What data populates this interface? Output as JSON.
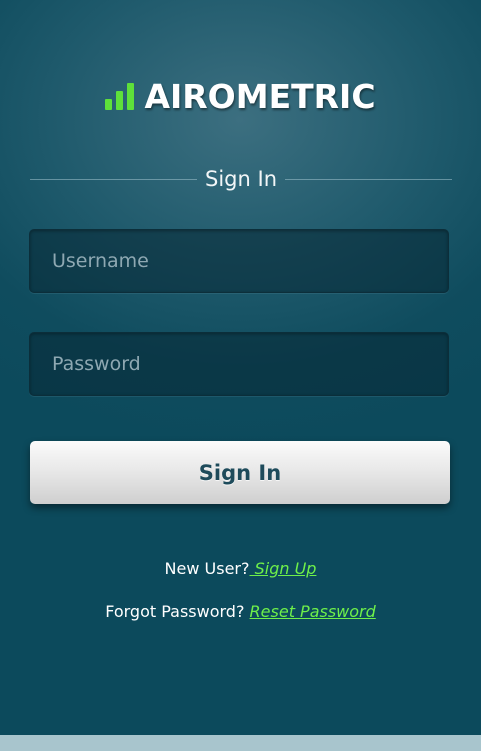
{
  "app": {
    "logo_text": "AIROMETRIC",
    "accent_color": "#5ee03a",
    "background_color": "#0f4c5e"
  },
  "signin": {
    "title": "Sign In",
    "username_placeholder": "Username",
    "password_placeholder": "Password",
    "button_label": "Sign In"
  },
  "links": {
    "new_user_text": "New User?",
    "sign_up_label": " Sign Up",
    "forgot_text": "Forgot Password? ",
    "reset_label": "Reset Password"
  }
}
